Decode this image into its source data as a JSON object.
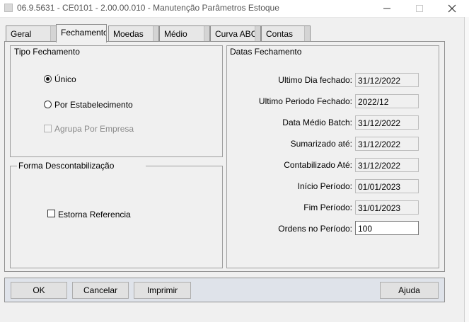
{
  "window": {
    "title": "06.9.5631 - CE0101 - 2.00.00.010 - Manutenção Parâmetros Estoque"
  },
  "tabs": [
    {
      "label": "Geral"
    },
    {
      "label": "Fechamento"
    },
    {
      "label": "Moedas"
    },
    {
      "label": "Médio"
    },
    {
      "label": "Curva ABC"
    },
    {
      "label": "Contas"
    }
  ],
  "tipo_fechamento": {
    "title": "Tipo Fechamento",
    "options": [
      {
        "label": "Único",
        "selected": true
      },
      {
        "label": "Por Estabelecimento",
        "selected": false
      }
    ],
    "agrupa_label": "Agrupa Por Empresa"
  },
  "forma_descontabilizacao": {
    "title": "Forma Descontabilização",
    "estorna_label": "Estorna Referencia"
  },
  "datas_fechamento": {
    "title": "Datas Fechamento",
    "fields": [
      {
        "label": "Ultimo Dia fechado:",
        "value": "31/12/2022"
      },
      {
        "label": "Ultimo Periodo Fechado:",
        "value": "2022/12"
      },
      {
        "label": "Data Médio Batch:",
        "value": "31/12/2022"
      },
      {
        "label": "Sumarizado até:",
        "value": "31/12/2022"
      },
      {
        "label": "Contabilizado Até:",
        "value": "31/12/2022"
      },
      {
        "label": "Início Período:",
        "value": "01/01/2023"
      },
      {
        "label": "Fim Período:",
        "value": "31/01/2023"
      },
      {
        "label": "Ordens no Período:",
        "value": "100"
      }
    ]
  },
  "buttons": {
    "ok": "OK",
    "cancel": "Cancelar",
    "print": "Imprimir",
    "help": "Ajuda"
  }
}
